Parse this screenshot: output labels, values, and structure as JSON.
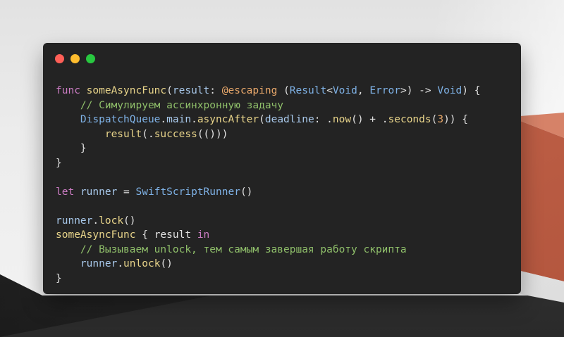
{
  "window": {
    "controls": [
      {
        "name": "close",
        "color": "#ff5f57"
      },
      {
        "name": "minimize",
        "color": "#febc2e"
      },
      {
        "name": "zoom",
        "color": "#28c840"
      }
    ]
  },
  "colors": {
    "keyword": "#cc7dc4",
    "function": "#e8d48a",
    "type": "#7fb2e6",
    "attribute": "#e8a76a",
    "comment": "#8fbf6a",
    "number": "#e8a76a",
    "text": "#e3e3e3",
    "identifier": "#a8c8ea"
  },
  "code_lines": [
    [
      {
        "t": "func",
        "c": "keyword"
      },
      {
        "t": " ",
        "c": "text"
      },
      {
        "t": "someAsyncFunc",
        "c": "function"
      },
      {
        "t": "(",
        "c": "text"
      },
      {
        "t": "result",
        "c": "identifier"
      },
      {
        "t": ": ",
        "c": "text"
      },
      {
        "t": "@escaping",
        "c": "attribute"
      },
      {
        "t": " (",
        "c": "text"
      },
      {
        "t": "Result",
        "c": "type"
      },
      {
        "t": "<",
        "c": "text"
      },
      {
        "t": "Void",
        "c": "type"
      },
      {
        "t": ", ",
        "c": "text"
      },
      {
        "t": "Error",
        "c": "type"
      },
      {
        "t": ">) -> ",
        "c": "text"
      },
      {
        "t": "Void",
        "c": "type"
      },
      {
        "t": ") {",
        "c": "text"
      }
    ],
    [
      {
        "t": "    ",
        "c": "text"
      },
      {
        "t": "// Симулируем ассинхронную задачу",
        "c": "comment"
      }
    ],
    [
      {
        "t": "    ",
        "c": "text"
      },
      {
        "t": "DispatchQueue",
        "c": "type"
      },
      {
        "t": ".",
        "c": "text"
      },
      {
        "t": "main",
        "c": "identifier"
      },
      {
        "t": ".",
        "c": "text"
      },
      {
        "t": "asyncAfter",
        "c": "function"
      },
      {
        "t": "(",
        "c": "text"
      },
      {
        "t": "deadline",
        "c": "identifier"
      },
      {
        "t": ": .",
        "c": "text"
      },
      {
        "t": "now",
        "c": "function"
      },
      {
        "t": "() + .",
        "c": "text"
      },
      {
        "t": "seconds",
        "c": "function"
      },
      {
        "t": "(",
        "c": "text"
      },
      {
        "t": "3",
        "c": "number"
      },
      {
        "t": ")) {",
        "c": "text"
      }
    ],
    [
      {
        "t": "        ",
        "c": "text"
      },
      {
        "t": "result",
        "c": "function"
      },
      {
        "t": "(.",
        "c": "text"
      },
      {
        "t": "success",
        "c": "function"
      },
      {
        "t": "(()))",
        "c": "text"
      }
    ],
    [
      {
        "t": "    }",
        "c": "text"
      }
    ],
    [
      {
        "t": "}",
        "c": "text"
      }
    ],
    [],
    [
      {
        "t": "let",
        "c": "keyword"
      },
      {
        "t": " ",
        "c": "text"
      },
      {
        "t": "runner",
        "c": "identifier"
      },
      {
        "t": " = ",
        "c": "text"
      },
      {
        "t": "SwiftScriptRunner",
        "c": "type"
      },
      {
        "t": "()",
        "c": "text"
      }
    ],
    [],
    [
      {
        "t": "runner",
        "c": "identifier"
      },
      {
        "t": ".",
        "c": "text"
      },
      {
        "t": "lock",
        "c": "function"
      },
      {
        "t": "()",
        "c": "text"
      }
    ],
    [
      {
        "t": "someAsyncFunc",
        "c": "function"
      },
      {
        "t": " { ",
        "c": "text"
      },
      {
        "t": "result",
        "c": "text"
      },
      {
        "t": " ",
        "c": "text"
      },
      {
        "t": "in",
        "c": "keyword"
      }
    ],
    [
      {
        "t": "    ",
        "c": "text"
      },
      {
        "t": "// Вызываем unlock, тем самым завершая работу скрипта",
        "c": "comment"
      }
    ],
    [
      {
        "t": "    ",
        "c": "text"
      },
      {
        "t": "runner",
        "c": "identifier"
      },
      {
        "t": ".",
        "c": "text"
      },
      {
        "t": "unlock",
        "c": "function"
      },
      {
        "t": "()",
        "c": "text"
      }
    ],
    [
      {
        "t": "}",
        "c": "text"
      }
    ]
  ]
}
